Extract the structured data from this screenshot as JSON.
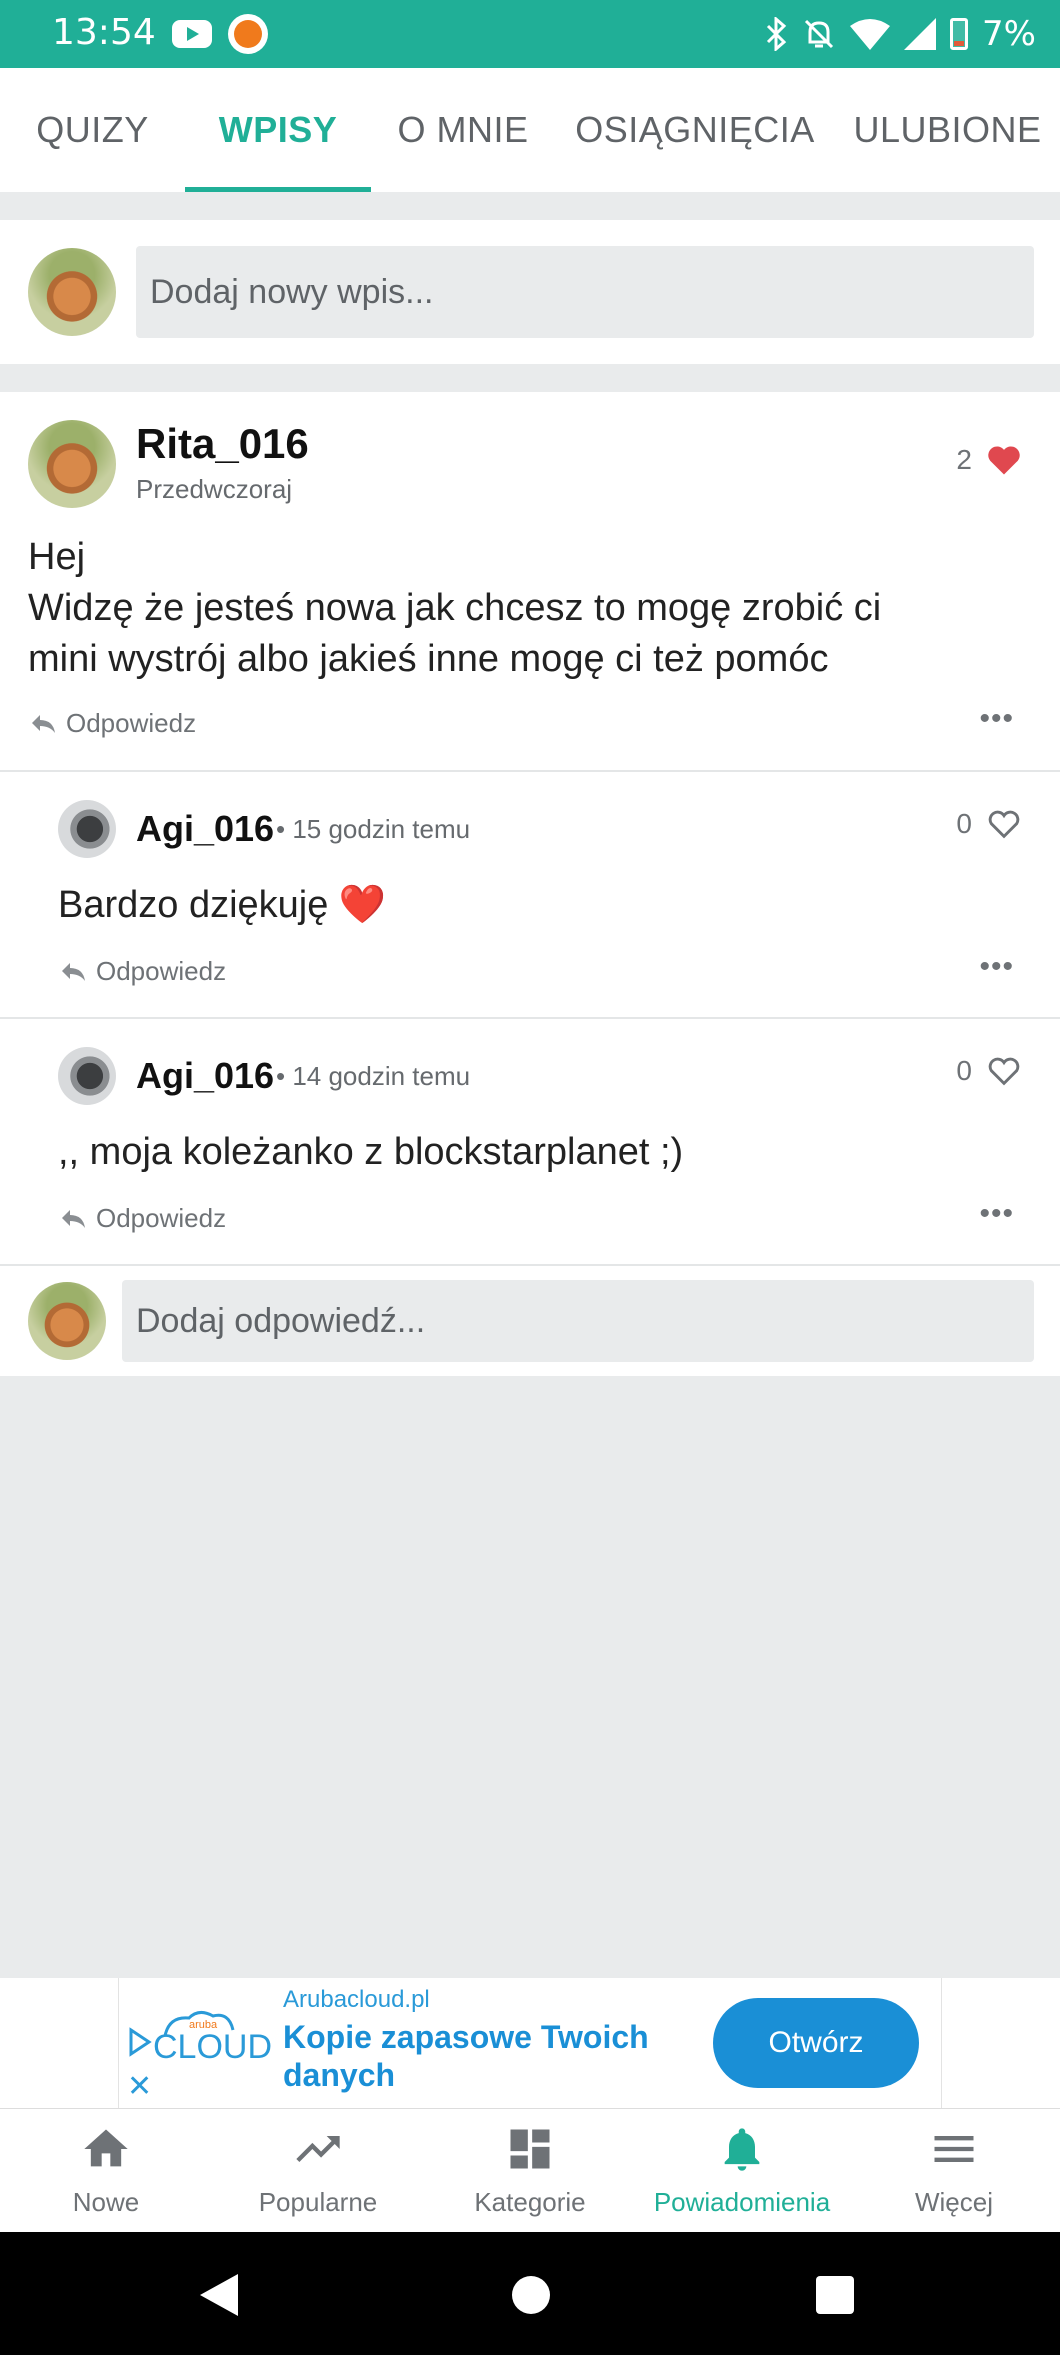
{
  "status_bar": {
    "time": "13:54",
    "battery": "7%",
    "icons": [
      "youtube-icon",
      "app-icon",
      "bluetooth-icon",
      "notifications-off-icon",
      "wifi-icon",
      "signal-icon",
      "battery-icon"
    ]
  },
  "tabs": [
    {
      "label": "QUIZY"
    },
    {
      "label": "WPISY"
    },
    {
      "label": "O MNIE"
    },
    {
      "label": "OSIĄGNIĘCIA"
    },
    {
      "label": "ULUBIONE"
    }
  ],
  "new_post": {
    "placeholder": "Dodaj nowy wpis..."
  },
  "post": {
    "author": "Rita_016",
    "time": "Przedwczoraj",
    "likes": "2",
    "liked": true,
    "body_line1": "Hej",
    "body_line2": "Widzę że jesteś nowa jak chcesz to mogę zrobić ci",
    "body_line3": "mini wystrój albo jakieś inne mogę ci też pomóc",
    "reply_label": "Odpowiedz"
  },
  "replies": [
    {
      "author": "Agi_016",
      "time": "• 15 godzin temu",
      "likes": "0",
      "body": "Bardzo dziękuję ❤️",
      "reply_label": "Odpowiedz"
    },
    {
      "author": "Agi_016",
      "time": "• 14 godzin temu",
      "likes": "0",
      "body": ",, moja koleżanko z blockstarplanet ;)",
      "reply_label": "Odpowiedz"
    }
  ],
  "add_reply": {
    "placeholder": "Dodaj odpowiedź..."
  },
  "ad": {
    "logo_text": "CLOUD",
    "logo_small": "aruba",
    "domain": "Arubacloud.pl",
    "title": "Kopie zapasowe Twoich danych",
    "button": "Otwórz"
  },
  "bottom_nav": [
    {
      "label": "Nowe",
      "icon": "home-icon"
    },
    {
      "label": "Popularne",
      "icon": "trending-icon"
    },
    {
      "label": "Kategorie",
      "icon": "dashboard-icon"
    },
    {
      "label": "Powiadomienia",
      "icon": "bell-icon"
    },
    {
      "label": "Więcej",
      "icon": "menu-icon"
    }
  ],
  "colors": {
    "accent": "#20af97",
    "ad_blue": "#1a8fd6",
    "heart_red": "#e0484f",
    "background": "#e9ebec"
  }
}
